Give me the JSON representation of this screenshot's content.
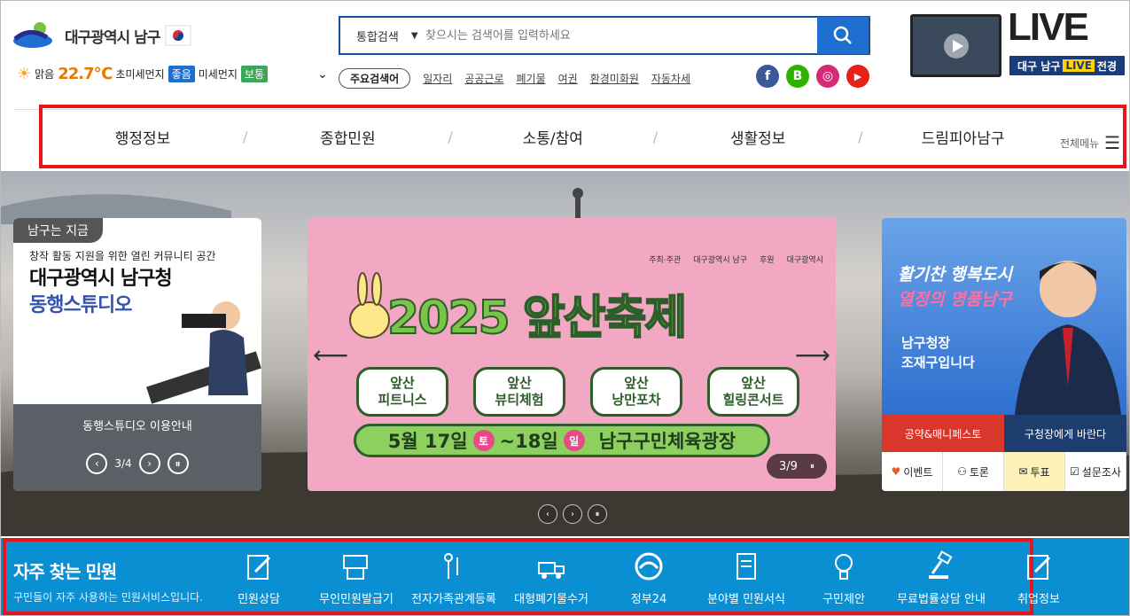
{
  "header": {
    "logo_text": "대구광역시 남구",
    "weather": {
      "condition": "맑음",
      "temperature": "22.7℃",
      "fine_dust_label": "초미세먼지",
      "fine_dust_value": "좋음",
      "dust_label": "미세먼지",
      "dust_value": "보통"
    },
    "search": {
      "scope": "통합검색",
      "placeholder": "찾으시는 검색어를 입력하세요"
    },
    "keywords_title": "주요검색어",
    "keywords": [
      "일자리",
      "공공근로",
      "폐기물",
      "여권",
      "환경미화원",
      "자동차세"
    ],
    "social": [
      "f",
      "B",
      "◎",
      "▶"
    ],
    "live": {
      "word": "LIVE",
      "caption_pre": "대구 남구",
      "caption_tag": "LIVE",
      "caption_post": "전경"
    }
  },
  "nav": {
    "items": [
      "행정정보",
      "종합민원",
      "소통/참여",
      "생활정보",
      "드림피아남구"
    ],
    "all_menu": "전체메뉴"
  },
  "left_card": {
    "tag": "남구는 지금",
    "subtitle": "창작 활동 지원을 위한 열린 커뮤니티 공간",
    "title_line1": "대구광역시 남구청",
    "title_line2": "동행스튜디오",
    "caption": "동행스튜디오 이용안내",
    "pager": "3/4"
  },
  "center_card": {
    "title": "2025 앞산축제",
    "tiles": [
      [
        "앞산",
        "피트니스"
      ],
      [
        "앞산",
        "뷰티체험"
      ],
      [
        "앞산",
        "낭만포차"
      ],
      [
        "앞산",
        "힐링콘서트"
      ]
    ],
    "date_a": "5월 17일",
    "day_a": "토",
    "date_b": "~18일",
    "day_b": "일",
    "venue": "남구구민체육광장",
    "pager": "3/9",
    "hosts": [
      "주최·주관",
      "대구광역시 남구",
      "후원",
      "대구광역시"
    ]
  },
  "right_card": {
    "slogan_line1": "활기찬 행복도시",
    "slogan_line2": "열정의 명품남구",
    "name_line1": "남구청장",
    "name_line2": "조재구입니다",
    "btn_pledge": "공약&매니페스토",
    "btn_request": "구청장에게 바란다",
    "icons": [
      "이벤트",
      "토론",
      "투표",
      "설문조사"
    ]
  },
  "civil": {
    "title": "자주 찾는 민원",
    "subtitle": "구민들이 자주 사용하는 민원서비스입니다.",
    "items": [
      "민원상담",
      "무인민원발급기",
      "전자가족관계등록",
      "대형폐기물수거",
      "정부24",
      "분야별 민원서식",
      "구민제안",
      "무료법률상담 안내",
      "취업정보"
    ]
  },
  "colors": {
    "accent": "#1f6fd1",
    "highlight": "#e8141c",
    "bottom_bar": "#0b8fd3"
  }
}
